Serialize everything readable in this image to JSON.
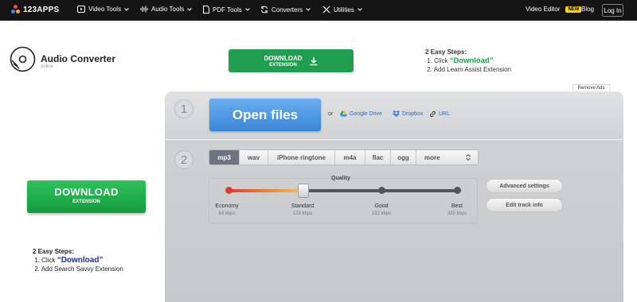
{
  "nav": {
    "logo_text": "123APPS",
    "items": [
      {
        "label": "Video Tools"
      },
      {
        "label": "Audio Tools"
      },
      {
        "label": "PDF Tools"
      },
      {
        "label": "Converters"
      },
      {
        "label": "Utilities"
      }
    ],
    "video_editor": "Video Editor",
    "new_badge": "NEW",
    "blog": "Blog",
    "login": "Log In"
  },
  "app": {
    "title": "Audio Converter",
    "subtitle": "online"
  },
  "promo_top": {
    "button_line1": "DOWNLOAD",
    "button_line2": "EXTENSION",
    "steps_title": "2 Easy Steps:",
    "step1_prefix": "1. Click ",
    "step1_highlight": "“Download”",
    "step2": "2. Add Learn Assist Extension"
  },
  "remove_ads": "Remove Ads",
  "step_open": {
    "number": "1",
    "open_files": "Open files",
    "or": "or",
    "sources": [
      "Google Drive",
      "Dropbox",
      "URL"
    ]
  },
  "step_format": {
    "number": "2",
    "formats": [
      "mp3",
      "wav",
      "iPhone ringtone",
      "m4a",
      "flac",
      "ogg",
      "more"
    ],
    "selected_format": "mp3",
    "quality_label": "Quality",
    "quality_levels": [
      {
        "name": "Economy",
        "kbps": "64 kbps"
      },
      {
        "name": "Standard",
        "kbps": "128 kbps"
      },
      {
        "name": "Good",
        "kbps": "192 kbps"
      },
      {
        "name": "Best",
        "kbps": "320 kbps"
      }
    ],
    "selected_quality": "Standard",
    "advanced_settings": "Advanced settings",
    "edit_track_info": "Edit track info"
  },
  "promo_left": {
    "button_line1": "DOWNLOAD",
    "button_line2": "EXTENSION",
    "steps_title": "2 Easy Steps:",
    "step1_prefix": "1. Click ",
    "step1_highlight": "“Download”",
    "step2": "2. Add Search Savvy Extension"
  },
  "colors": {
    "nav_bg": "#141414",
    "download_green": "#1e9e4e",
    "open_files_blue": "#3a86d6",
    "new_badge": "#ffd400"
  }
}
